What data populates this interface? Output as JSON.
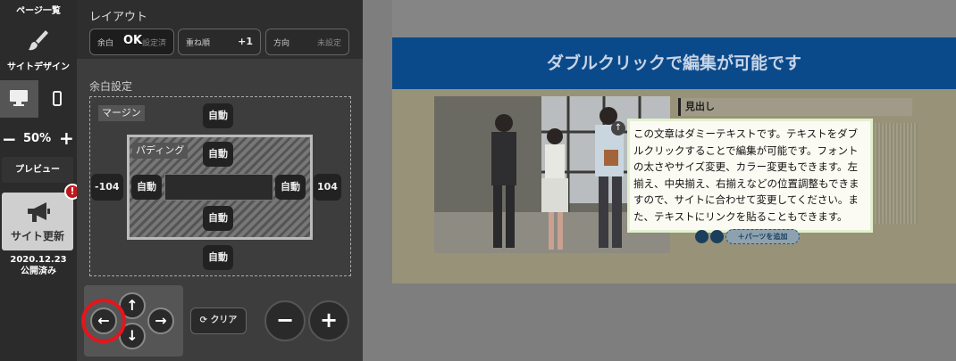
{
  "rail": {
    "pages_label": "ページ一覧",
    "site_design_label": "サイトデザイン",
    "zoom": {
      "minus": "−",
      "value": "50%",
      "plus": "+"
    },
    "preview_label": "プレビュー",
    "publish_label": "サイト更新",
    "badge": "!",
    "publish_date": "2020.12.23",
    "publish_status": "公開済み"
  },
  "panel": {
    "layout_title": "レイアウト",
    "layout_buttons": {
      "margin": {
        "key": "余白",
        "ok": "OK",
        "value": "設定済"
      },
      "order": {
        "key": "重ね順",
        "value": "+1"
      },
      "direction": {
        "key": "方向",
        "value": "未設定"
      }
    },
    "margin_title": "余白設定",
    "margin_tag": "マージン",
    "padding_tag": "パディング",
    "auto": "自動",
    "left_value": "-104",
    "right_value": "104",
    "arrows": {
      "up": "↑",
      "down": "↓",
      "left": "←",
      "right": "→"
    },
    "clear_label": "クリア",
    "minus": "−",
    "plus": "+"
  },
  "canvas": {
    "banner": "ダブルクリックで編集が可能です",
    "heading": "見出し",
    "body_text": "この文章はダミーテキストです。テキストをダブルクリックすることで編集が可能です。フォントの太さやサイズ変更、カラー変更もできます。左揃え、中央揃え、右揃えなどの位置調整もできますので、サイトに合わせて変更してください。また、テキストにリンクを貼ることもできます。",
    "add_parts_label": "＋パーツを追加"
  },
  "colors": {
    "banner": "#0b4a8a",
    "alert": "#e3161d",
    "highlight_ring": "#e3161d"
  }
}
